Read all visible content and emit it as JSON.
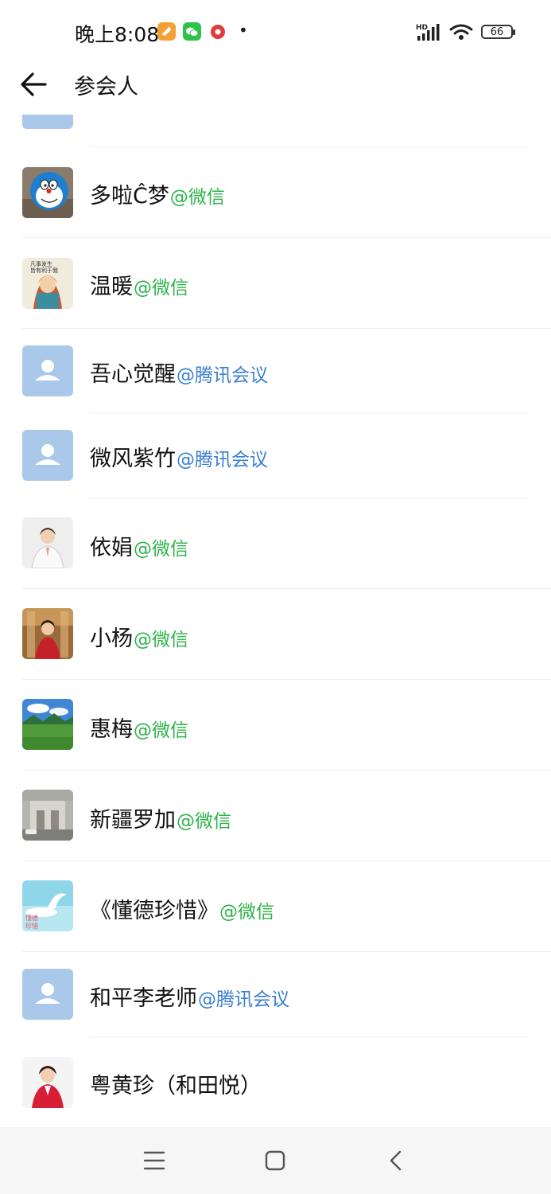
{
  "status_bar": {
    "time": "晚上8:08",
    "battery": "66",
    "icons": [
      "app-orange-icon",
      "wechat-icon",
      "recording-icon",
      "hd-signal-icon",
      "wifi-icon",
      "battery-icon"
    ]
  },
  "header": {
    "title": "参会人",
    "back_icon": "arrow-left-icon"
  },
  "participants": [
    {
      "name": "多啦Ĉ梦",
      "tag": "@微信",
      "source": "wechat",
      "avatar": "doraemon"
    },
    {
      "name": "温暖",
      "tag": "@微信",
      "source": "wechat",
      "avatar": "illustration-girl"
    },
    {
      "name": "吾心觉醒",
      "tag": "@腾讯会议",
      "source": "meeting",
      "avatar": "default"
    },
    {
      "name": "微风紫竹",
      "tag": "@腾讯会议",
      "source": "meeting",
      "avatar": "default"
    },
    {
      "name": "依娟",
      "tag": "@微信",
      "source": "wechat",
      "avatar": "woman-white"
    },
    {
      "name": "小杨",
      "tag": "@微信",
      "source": "wechat",
      "avatar": "woman-red"
    },
    {
      "name": "惠梅",
      "tag": "@微信",
      "source": "wechat",
      "avatar": "landscape"
    },
    {
      "name": "新疆罗加",
      "tag": "@微信",
      "source": "wechat",
      "avatar": "building"
    },
    {
      "name": "《懂德珍惜》",
      "tag": "@微信",
      "source": "wechat",
      "avatar": "dolphin"
    },
    {
      "name": "和平李老师",
      "tag": "@腾讯会议",
      "source": "meeting",
      "avatar": "default"
    },
    {
      "name": "粤黄珍（和田悦）",
      "tag": "",
      "source": "",
      "avatar": "woman-red-jacket"
    }
  ],
  "colors": {
    "wechat_tag": "#2db34a",
    "meeting_tag": "#3a7fd0",
    "default_avatar": "#a9c8ea"
  },
  "navbar": {
    "icons": [
      "menu-icon",
      "home-icon",
      "back-icon"
    ]
  }
}
